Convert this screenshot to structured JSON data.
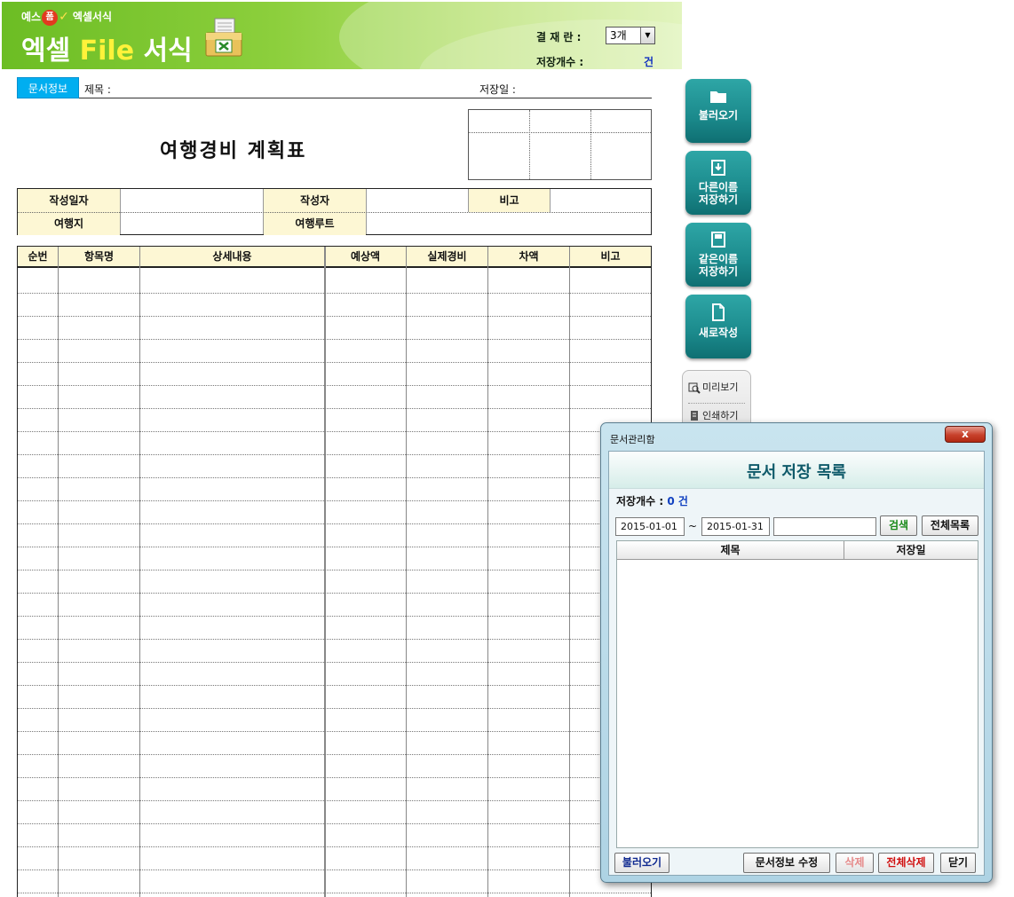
{
  "header": {
    "brand_small_left": "예스",
    "brand_small_badge": "폼",
    "brand_small_right": "엑셀서식",
    "brand_big_a": "엑셀",
    "brand_big_file": "File",
    "brand_big_b": "서식",
    "approval_label": "결 재 란 :",
    "approval_value": "3개",
    "save_count_label": "저장개수 :",
    "save_count_unit": "건"
  },
  "docinfo": {
    "tag": "문서정보",
    "title_label": "제목 :",
    "saved_date_label": "저장일 :"
  },
  "document": {
    "title": "여행경비 계획표"
  },
  "info_table": {
    "author_date": "작성일자",
    "author": "작성자",
    "note": "비고",
    "destination": "여행지",
    "route": "여행루트"
  },
  "main_table": {
    "columns": [
      "순번",
      "항목명",
      "상세내용",
      "예상액",
      "실제경비",
      "차액",
      "비고"
    ]
  },
  "side": {
    "load": "불러오기",
    "save_as_1": "다른이름",
    "save_as_2": "저장하기",
    "save_1": "같은이름",
    "save_2": "저장하기",
    "new": "새로작성",
    "preview": "미리보기",
    "print": "인쇄하기"
  },
  "dialog": {
    "window_title": "문서관리함",
    "close": "x",
    "heading": "문서 저장 목록",
    "count_label": "저장개수 :",
    "count_value": "0 건",
    "date_from": "2015-01-01",
    "tilde": "~",
    "date_to": "2015-01-31",
    "keyword": "",
    "search": "검색",
    "all_list": "전체목록",
    "col_title": "제목",
    "col_date": "저장일",
    "load": "불러오기",
    "edit_info": "문서정보 수정",
    "delete": "삭제",
    "delete_all": "전체삭제",
    "close_btn": "닫기"
  },
  "colors": {
    "banner_green": "#6cbd24",
    "docinfo_blue": "#00aef0",
    "header_yellow": "#fdf7d4",
    "side_teal": "#1b8a8c",
    "count_blue": "#1030c0",
    "search_green": "#1a8a1a",
    "delete_disabled": "#e68a8a",
    "delete_all_red": "#d01010"
  }
}
